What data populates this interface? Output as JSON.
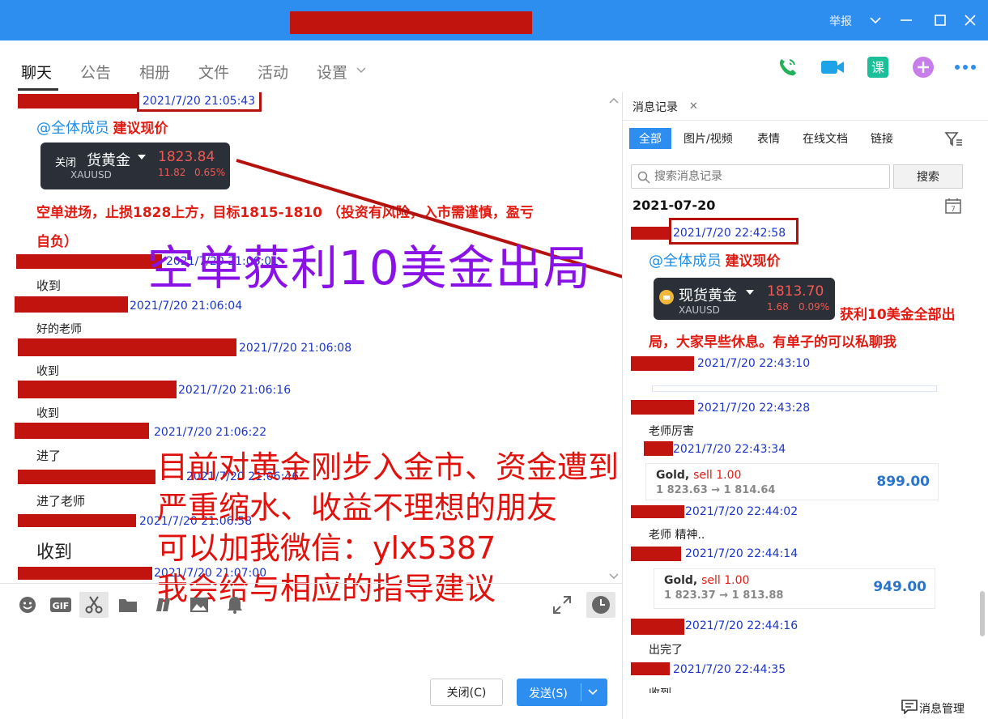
{
  "window": {
    "report_label": "举报",
    "colors": {
      "titlebar": "#2e8ef0",
      "accent": "#2e8ef0",
      "redaction": "#c2140f"
    }
  },
  "tabs": [
    {
      "label": "聊天"
    },
    {
      "label": "公告"
    },
    {
      "label": "相册"
    },
    {
      "label": "文件"
    },
    {
      "label": "活动"
    },
    {
      "label": "设置"
    }
  ],
  "header_icons": [
    "phone-icon",
    "video-icon",
    "class-icon",
    "plus-app-icon",
    "more-icon"
  ],
  "chat": {
    "messages": [
      {
        "time": "2021/7/20 21:05:43",
        "mention": "@全体成员",
        "highlight": "建议现价"
      },
      {
        "text": "空单进场，止损1828上方，目标1815-1810 （投资有风险，入市需谨慎，盈亏",
        "text2": "自负）"
      },
      {
        "time": "2021/7/20 21:06:01",
        "text": "收到"
      },
      {
        "time": "2021/7/20 21:06:04",
        "text": "好的老师"
      },
      {
        "time": "2021/7/20 21:06:08",
        "text": "收到"
      },
      {
        "time": "2021/7/20 21:06:16",
        "text": "收到"
      },
      {
        "time": "2021/7/20 21:06:22",
        "text": "进了"
      },
      {
        "time": "2021/7/20 21:06:46",
        "text": "进了老师"
      },
      {
        "time": "2021/7/20 21:06:58",
        "text": "收到"
      },
      {
        "time": "2021/7/20 21:07:00"
      }
    ],
    "card": {
      "close": "关闭",
      "name": "货黄金",
      "code": "XAUUSD",
      "price": "1823.84",
      "change": "11.82",
      "percent": "0.65%"
    },
    "overlay_purple": "空单获利10美金出局",
    "overlay_red": [
      "目前对黄金刚步入金市、资金遭到",
      "严重缩水、收益不理想的朋友",
      "可以加我微信：ylx5387",
      "我会给与相应的指导建议"
    ]
  },
  "toolbar": {
    "tools": [
      "emoji-icon",
      "gif-icon",
      "scissors-icon",
      "folder-icon",
      "text-style-icon",
      "image-icon",
      "bell-icon"
    ],
    "expand": "expand-icon",
    "history": "clock-icon",
    "close_label": "关闭(C)",
    "send_label": "发送(S)"
  },
  "panel": {
    "title": "消息记录",
    "filters": [
      "全部",
      "图片/视频",
      "表情",
      "在线文档",
      "链接"
    ],
    "search_placeholder": "搜索消息记录",
    "search_button": "搜索",
    "date": "2021-07-20",
    "calendar_day": "7",
    "records": [
      {
        "time": "2021/7/20 22:42:58",
        "mention": "@全体成员",
        "highlight": "建议现价"
      },
      {
        "text": "获利10美金全部出",
        "text2": "局，大家早些休息。有单子的可以私聊我"
      },
      {
        "time": "2021/7/20 22:43:10"
      },
      {
        "time": "2021/7/20 22:43:28",
        "text": "老师厉害"
      },
      {
        "time": "2021/7/20 22:43:34"
      },
      {
        "time": "2021/7/20 22:44:02",
        "text": "老师 精神.."
      },
      {
        "time": "2021/7/20 22:44:14"
      },
      {
        "time": "2021/7/20 22:44:16",
        "text": "出完了"
      },
      {
        "time": "2021/7/20 22:44:35",
        "text": "收到"
      }
    ],
    "card": {
      "name": "现货黄金",
      "code": "XAUUSD",
      "price": "1813.70",
      "change": "1.68",
      "percent": "0.09%"
    },
    "trades": [
      {
        "symbol": "Gold,",
        "side": "sell 1.00",
        "path": "1 823.63 → 1 814.64",
        "amount": "899.00"
      },
      {
        "symbol": "Gold,",
        "side": "sell 1.00",
        "path": "1 823.37 → 1 813.88",
        "amount": "949.00"
      }
    ],
    "manage_label": "消息管理"
  }
}
